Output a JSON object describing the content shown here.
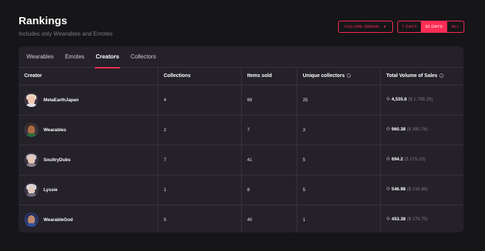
{
  "header": {
    "title": "Rankings",
    "subtitle": "Includes only Wearables and Emotes"
  },
  "controls": {
    "dropdown_label": "VOLUME (MANA)",
    "ranges": [
      "7 DAYS",
      "30 DAYS",
      "ALL"
    ],
    "active_range": "30 DAYS"
  },
  "tabs": [
    "Wearables",
    "Emotes",
    "Creators",
    "Collectors"
  ],
  "active_tab": "Creators",
  "table": {
    "columns": [
      "Creator",
      "Collections",
      "Items sold",
      "Unique collectors",
      "Total Volume of Sales"
    ],
    "rows": [
      {
        "creator": "MetaEarthJapan",
        "collections": "4",
        "items_sold": "69",
        "unique_collectors": "25",
        "volume": "4,535.8",
        "usd": "($ 1,798.29)"
      },
      {
        "creator": "Wearables",
        "collections": "2",
        "items_sold": "7",
        "unique_collectors": "3",
        "volume": "960.38",
        "usd": "($ 380.76)"
      },
      {
        "creator": "SoultryDubs",
        "collections": "7",
        "items_sold": "41",
        "unique_collectors": "5",
        "volume": "694.2",
        "usd": "($ 275.23)"
      },
      {
        "creator": "Lyssie",
        "collections": "1",
        "items_sold": "8",
        "unique_collectors": "5",
        "volume": "546.98",
        "usd": "($ 216.86)"
      },
      {
        "creator": "WearableGod",
        "collections": "5",
        "items_sold": "40",
        "unique_collectors": "1",
        "volume": "453.38",
        "usd": "($ 179.75)"
      }
    ]
  },
  "icons": {
    "mana": "mana-icon",
    "info": "info-icon",
    "caret": "caret-down-icon"
  },
  "colors": {
    "accent": "#ff2d55",
    "background": "#161518",
    "card": "#242129"
  }
}
